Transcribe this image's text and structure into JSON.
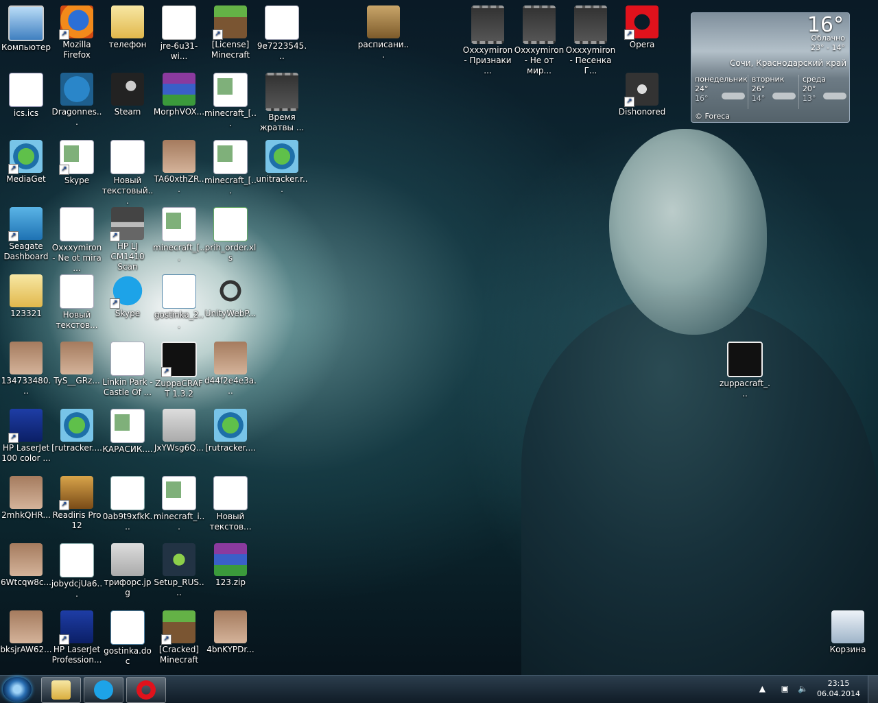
{
  "desktop_icons": [
    {
      "label": "Компьютер",
      "icon": "computer-icon"
    },
    {
      "label": "Mozilla Firefox",
      "icon": "firefox-icon"
    },
    {
      "label": "телефон",
      "icon": "folder-icon"
    },
    {
      "label": "jre-6u31-wi...",
      "icon": "java-icon"
    },
    {
      "label": "[License] Minecraft",
      "icon": "minecraft-icon"
    },
    {
      "label": "9e7223545...",
      "icon": "mp3-icon"
    },
    {
      "label": "расписани...",
      "icon": "archive-box-icon"
    },
    {
      "label": "Oxxxymiron - Признаки ...",
      "icon": "video-icon"
    },
    {
      "label": "Oxxxymiron - Не от мир...",
      "icon": "video-icon"
    },
    {
      "label": "Oxxxymiron - Песенка Г...",
      "icon": "video-icon"
    },
    {
      "label": "Opera",
      "icon": "opera-icon"
    },
    {
      "label": "ics.ics",
      "icon": "calendar-icon"
    },
    {
      "label": "Dragonnes...",
      "icon": "download-icon"
    },
    {
      "label": "Steam",
      "icon": "steam-icon"
    },
    {
      "label": "MorphVOX...",
      "icon": "winrar-icon"
    },
    {
      "label": "minecraft_[...",
      "icon": "window-icon"
    },
    {
      "label": "Время жратвы ...",
      "icon": "video-icon"
    },
    {
      "label": "Dishonored",
      "icon": "dishonored-icon"
    },
    {
      "label": "MediaGet",
      "icon": "mediaget-icon"
    },
    {
      "label": "Skype",
      "icon": "window-icon"
    },
    {
      "label": "Новый текстовый...",
      "icon": "text-file-icon"
    },
    {
      "label": "TA60xthZR...",
      "icon": "photo-icon"
    },
    {
      "label": "minecraft_[...",
      "icon": "window-icon"
    },
    {
      "label": "unitracker.r...",
      "icon": "mediaget-icon"
    },
    {
      "label": "Seagate Dashboard",
      "icon": "seagate-icon"
    },
    {
      "label": "Oxxxymiron - Ne ot mira ...",
      "icon": "mp3-icon"
    },
    {
      "label": "HP LJ CM1410 Scan",
      "icon": "scanner-icon"
    },
    {
      "label": "minecraft_[...",
      "icon": "window-icon"
    },
    {
      "label": "prih_order.xls",
      "icon": "excel-icon"
    },
    {
      "label": "123321",
      "icon": "folder-icon"
    },
    {
      "label": "Новый текстов...",
      "icon": "text-file-icon"
    },
    {
      "label": "Skype",
      "icon": "skype-icon"
    },
    {
      "label": "gostinka_2...",
      "icon": "word-icon"
    },
    {
      "label": "UnityWebP...",
      "icon": "unity-icon"
    },
    {
      "label": "134733480...",
      "icon": "photo-icon"
    },
    {
      "label": "TyS__GRz...",
      "icon": "photo-icon"
    },
    {
      "label": "Linkin Park - Castle Of ...",
      "icon": "mp3-icon"
    },
    {
      "label": "ZuppaCRAFT 1.3.2",
      "icon": "zp-icon"
    },
    {
      "label": "d44f2e4e3a...",
      "icon": "video-icon"
    },
    {
      "label": "zuppacraft_...",
      "icon": "zp-icon"
    },
    {
      "label": "HP LaserJet 100 color ...",
      "icon": "hp-icon"
    },
    {
      "label": "[rutracker....",
      "icon": "mediaget-icon"
    },
    {
      "label": "КАРАСИК....",
      "icon": "photo-icon"
    },
    {
      "label": "JxYWsg6Q...",
      "icon": "photo-icon"
    },
    {
      "label": "[rutracker....",
      "icon": "mediaget-icon"
    },
    {
      "label": "2mhkQHR...",
      "icon": "photo-icon"
    },
    {
      "label": "Readiris Pro 12",
      "icon": "readiris-icon"
    },
    {
      "label": "0ab9t9xfkK...",
      "icon": "screenshot-icon"
    },
    {
      "label": "minecraft_i...",
      "icon": "window-icon"
    },
    {
      "label": "Новый текстов...",
      "icon": "text-file-icon"
    },
    {
      "label": "6Wtcqw8c...",
      "icon": "photo-icon"
    },
    {
      "label": "jobydcjUa6...",
      "icon": "screenshot-icon"
    },
    {
      "label": "трифорс.jpg",
      "icon": "photo-icon"
    },
    {
      "label": "Setup_RUS....",
      "icon": "setup-icon"
    },
    {
      "label": "123.zip",
      "icon": "winrar-icon"
    },
    {
      "label": "bksjrAW62...",
      "icon": "photo-icon"
    },
    {
      "label": "HP LaserJet Profession...",
      "icon": "hp-icon"
    },
    {
      "label": "gostinka.doc",
      "icon": "word-icon"
    },
    {
      "label": "[Cracked] Minecraft",
      "icon": "minecraft-icon"
    },
    {
      "label": "4bnKYPDr...",
      "icon": "photo-icon"
    },
    {
      "label": "Корзина",
      "icon": "recycle-bin-icon"
    }
  ],
  "weather": {
    "temperature": "16°",
    "condition": "Облачно",
    "range": "23° - 14°",
    "city": "Сочи, Краснодарский край",
    "forecast": [
      {
        "day": "понедельник",
        "high": "24°",
        "low": "16°"
      },
      {
        "day": "вторник",
        "high": "26°",
        "low": "14°"
      },
      {
        "day": "среда",
        "high": "20°",
        "low": "13°"
      }
    ],
    "credit": "© Foreca"
  },
  "taskbar": {
    "pinned": [
      "explorer",
      "skype",
      "opera"
    ],
    "time": "23:15",
    "date": "06.04.2014"
  }
}
